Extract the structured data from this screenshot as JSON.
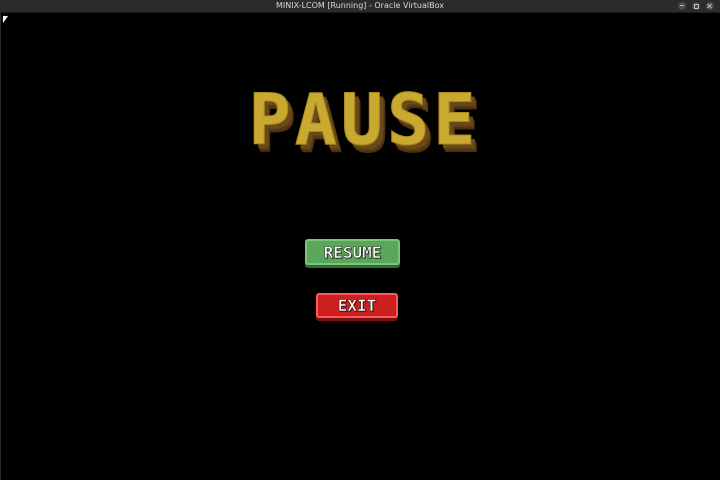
{
  "window": {
    "title": "MINIX-LCOM [Running] - Oracle VirtualBox",
    "controls": [
      "minimize-icon",
      "maximize-icon",
      "close-icon"
    ]
  },
  "game": {
    "title": "PAUSE",
    "title_color": "#c9a930",
    "title_shadow_color": "#6a4a1a",
    "buttons": {
      "resume_label": "RESUME",
      "resume_color": "#5aa65a",
      "exit_label": "EXIT",
      "exit_color": "#cc1f1f"
    }
  }
}
